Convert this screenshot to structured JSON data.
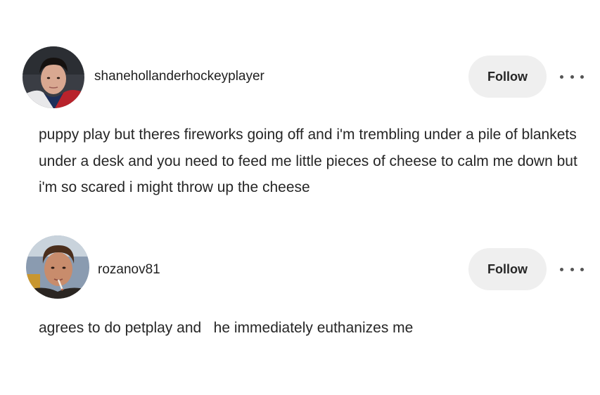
{
  "posts": [
    {
      "username": "shanehollanderhockeyplayer",
      "follow_label": "Follow",
      "text": "puppy play but theres fireworks going off and i'm trembling under a pile of blankets under a desk and you need to feed me little pieces of cheese to calm me down but i'm so scared i might throw up the cheese"
    },
    {
      "username": "rozanov81",
      "follow_label": "Follow",
      "text": "agrees to do petplay and   he immediately euthanizes me"
    }
  ],
  "colors": {
    "background": "#ffffff",
    "follow_button_bg": "#efefef",
    "text": "#262626",
    "icon": "#555555"
  },
  "icons": [
    "more-options-icon"
  ]
}
